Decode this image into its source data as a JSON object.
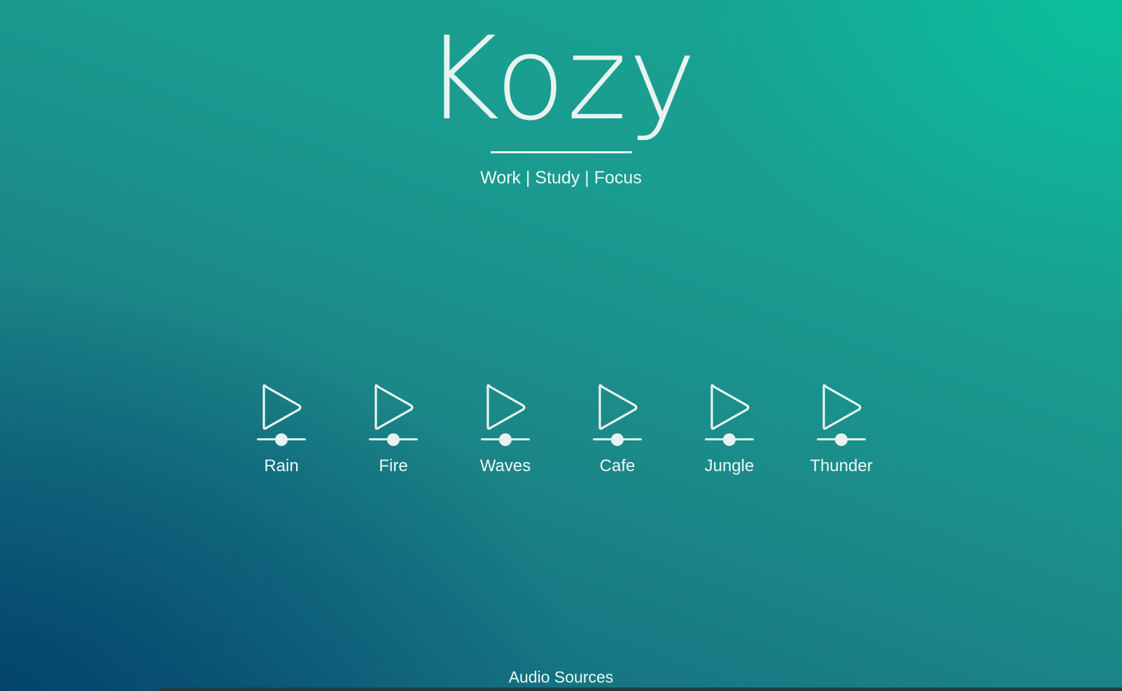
{
  "app": {
    "title": "Kozy",
    "tagline": "Work | Study | Focus"
  },
  "sounds": [
    {
      "label": "Rain",
      "volume": 0.5,
      "icon": "play-icon"
    },
    {
      "label": "Fire",
      "volume": 0.5,
      "icon": "play-icon"
    },
    {
      "label": "Waves",
      "volume": 0.5,
      "icon": "play-icon"
    },
    {
      "label": "Cafe",
      "volume": 0.5,
      "icon": "play-icon"
    },
    {
      "label": "Jungle",
      "volume": 0.5,
      "icon": "play-icon"
    },
    {
      "label": "Thunder",
      "volume": 0.5,
      "icon": "play-icon"
    }
  ],
  "footer": {
    "link_label": "Audio Sources"
  },
  "colors": {
    "foreground": "#e8f3f1",
    "gradient_top_right": "#00d6a4",
    "gradient_bottom_left": "#003e68"
  }
}
